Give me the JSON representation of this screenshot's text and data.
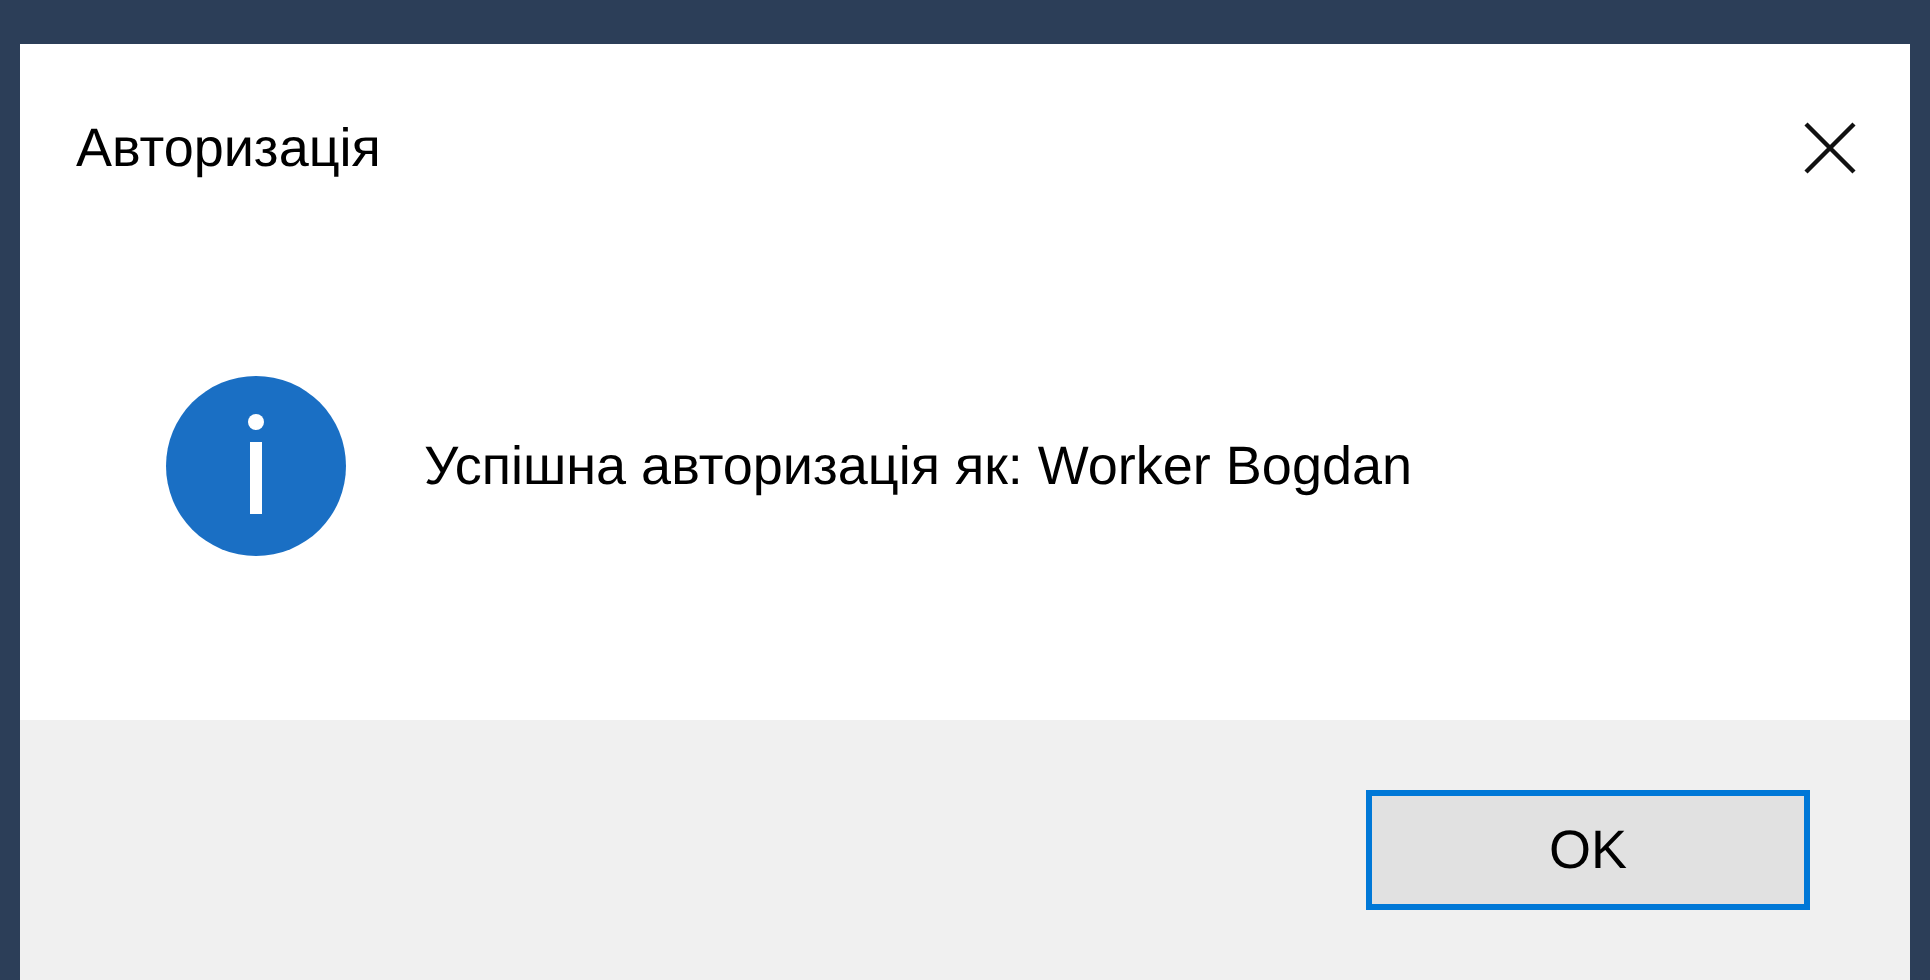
{
  "window": {
    "title": "Авторизація"
  },
  "message": {
    "kind": "info",
    "text": "Успішна авторизація як: Worker Bogdan"
  },
  "buttons": [
    {
      "label": "OK",
      "default": true
    }
  ]
}
